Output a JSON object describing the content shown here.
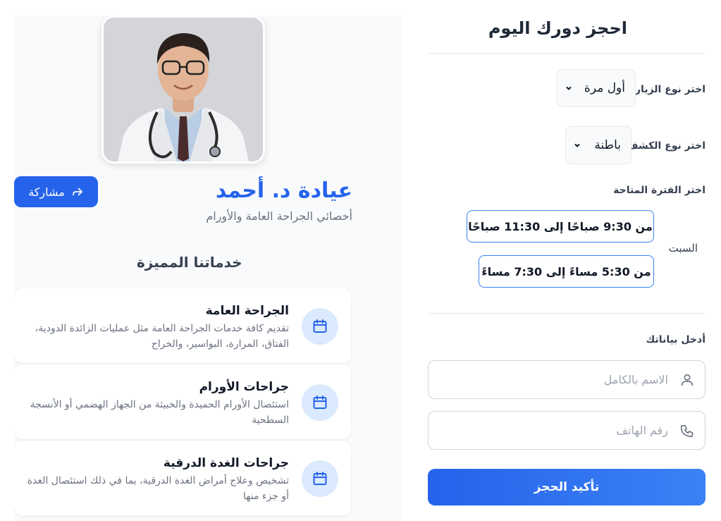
{
  "profile": {
    "share_label": "مشاركة",
    "doctor_name": "عيادة د. أحمد",
    "doctor_title": "أخصائي الجراحة العامة والأورام",
    "services_heading": "خدماتنا المميزة",
    "services": [
      {
        "title": "الجراحة العامة",
        "description": "تقديم كافة خدمات الجراحة العامة مثل عمليات الزائدة الدودية، الفتاق، المرارة، البواسير، والخراج",
        "icon": "calendar-icon"
      },
      {
        "title": "جراحات الأورام",
        "description": "استئصال الأورام الحميدة والخبيثة من الجهاز الهضمي أو الأنسجة السطحية",
        "icon": "calendar-icon"
      },
      {
        "title": "جراحات الغدة الدرقية",
        "description": "تشخيص وعلاج أمراض الغدة الدرقية، بما في ذلك استئصال الغدة أو جزء منها",
        "icon": "calendar-icon"
      }
    ]
  },
  "booking": {
    "title": "احجز دورك اليوم",
    "visit_type_label": "اختر نوع الزيارة",
    "visit_type_value": "أول مرة",
    "exam_type_label": "اختر نوع الكشف",
    "exam_type_value": "باطنة",
    "period_label": "اختر الفترة المتاحة",
    "day": "السبت",
    "slots": [
      "من 9:30 صباحًا إلى 11:30 صباحًا",
      "من 5:30 مساءً إلى 7:30 مساءً"
    ],
    "details_label": "أدخل بياناتك",
    "name_placeholder": "الاسم بالكامل",
    "phone_placeholder": "رقم الهاتف",
    "confirm_label": "تأكيد الحجز"
  },
  "colors": {
    "accent": "#2563eb",
    "panel_bg": "#f8fafc",
    "icon_bg": "#dbeafe"
  }
}
